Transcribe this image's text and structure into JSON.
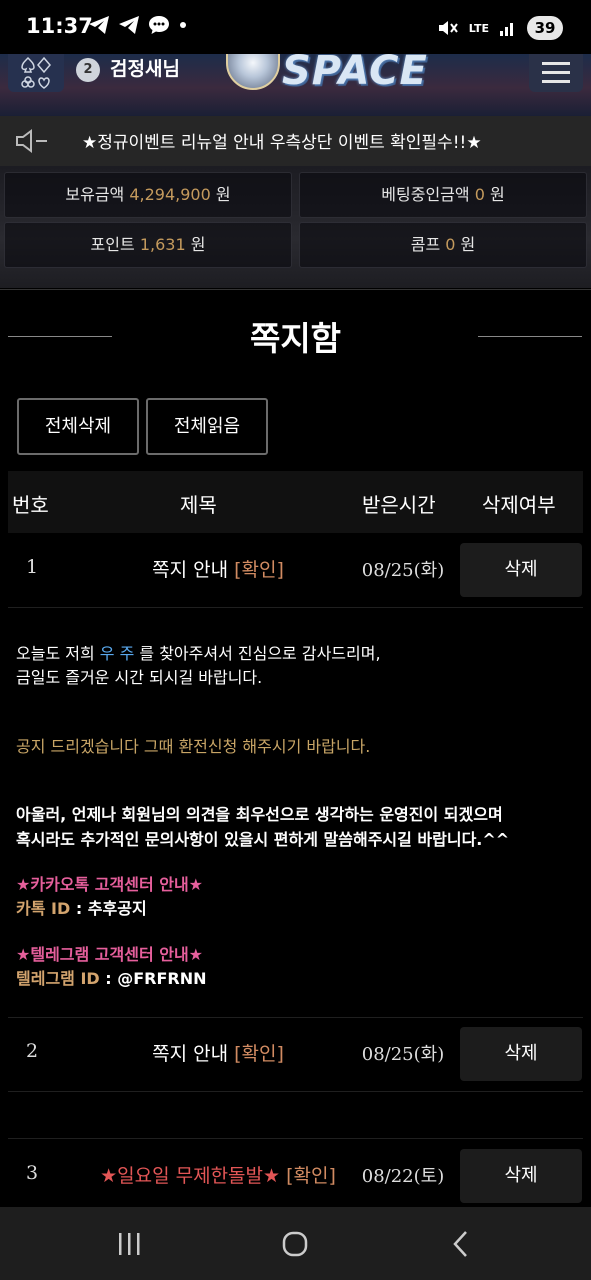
{
  "status_bar": {
    "time": "11:37",
    "network": "LTE",
    "battery": "39",
    "icons": [
      "telegram-icon",
      "telegram-icon",
      "chat-bubble-icon",
      "dot-icon",
      "mute-icon",
      "signal-icon",
      "battery-icon"
    ]
  },
  "header": {
    "level": "2",
    "nickname": "검정새님",
    "logo_text": "SPACE",
    "icons": [
      "card-suits-icon",
      "menu-icon"
    ]
  },
  "notice": {
    "text": "★정규이벤트 리뉴얼 안내 우측상단 이벤트 확인필수!!★",
    "icon": "speaker-icon"
  },
  "balances": {
    "holding_label": "보유금액",
    "holding_value": "4,294,900",
    "holding_unit": "원",
    "betting_label": "베팅중인금액",
    "betting_value": "0",
    "betting_unit": "원",
    "point_label": "포인트",
    "point_value": "1,631",
    "point_unit": "원",
    "comp_label": "콤프",
    "comp_value": "0",
    "comp_unit": "원"
  },
  "panel": {
    "title": "쪽지함",
    "delete_all": "전체삭제",
    "read_all": "전체읽음"
  },
  "table": {
    "headers": [
      "번호",
      "제목",
      "받은시간",
      "삭제여부"
    ],
    "rows": [
      {
        "num": "1",
        "title": "쪽지 안내",
        "status": "[확인]",
        "date": "08/25(화)",
        "action": "삭제"
      },
      {
        "num": "2",
        "title": "쪽지 안내",
        "status": "[확인]",
        "date": "08/25(화)",
        "action": "삭제"
      },
      {
        "num": "3",
        "title": "★일요일 무제한돌발★",
        "status": "[확인]",
        "date": "08/22(토)",
        "action": "삭제"
      }
    ]
  },
  "message": {
    "l1_a": "오늘도 저희 ",
    "l1_b": "우 주",
    "l1_c": " 를 찾아주셔서 진심으로 감사드리며,",
    "l2": "금일도 즐거운 시간 되시길 바랍니다.",
    "l3": "공지 드리겠습니다 그때 환전신청 해주시기 바랍니다.",
    "l4": "아울러, 언제나 회원님의 의견을 최우선으로 생각하는 운영진이 되겠으며",
    "l5": "혹시라도 추가적인 문의사항이 있을시 편하게 말씀해주시길 바랍니다.^^",
    "kakao_header": "★카카오톡 고객센터 안내★",
    "kakao_label": "카톡 ID",
    "kakao_sep": " : ",
    "kakao_value": "추후공지",
    "tg_header": "★텔레그램 고객센터 안내★",
    "tg_label": "텔레그램 ID",
    "tg_sep": " : ",
    "tg_value": "@FRFRNN"
  },
  "nav": {
    "icons": [
      "recent-apps-icon",
      "home-icon",
      "back-icon"
    ]
  }
}
